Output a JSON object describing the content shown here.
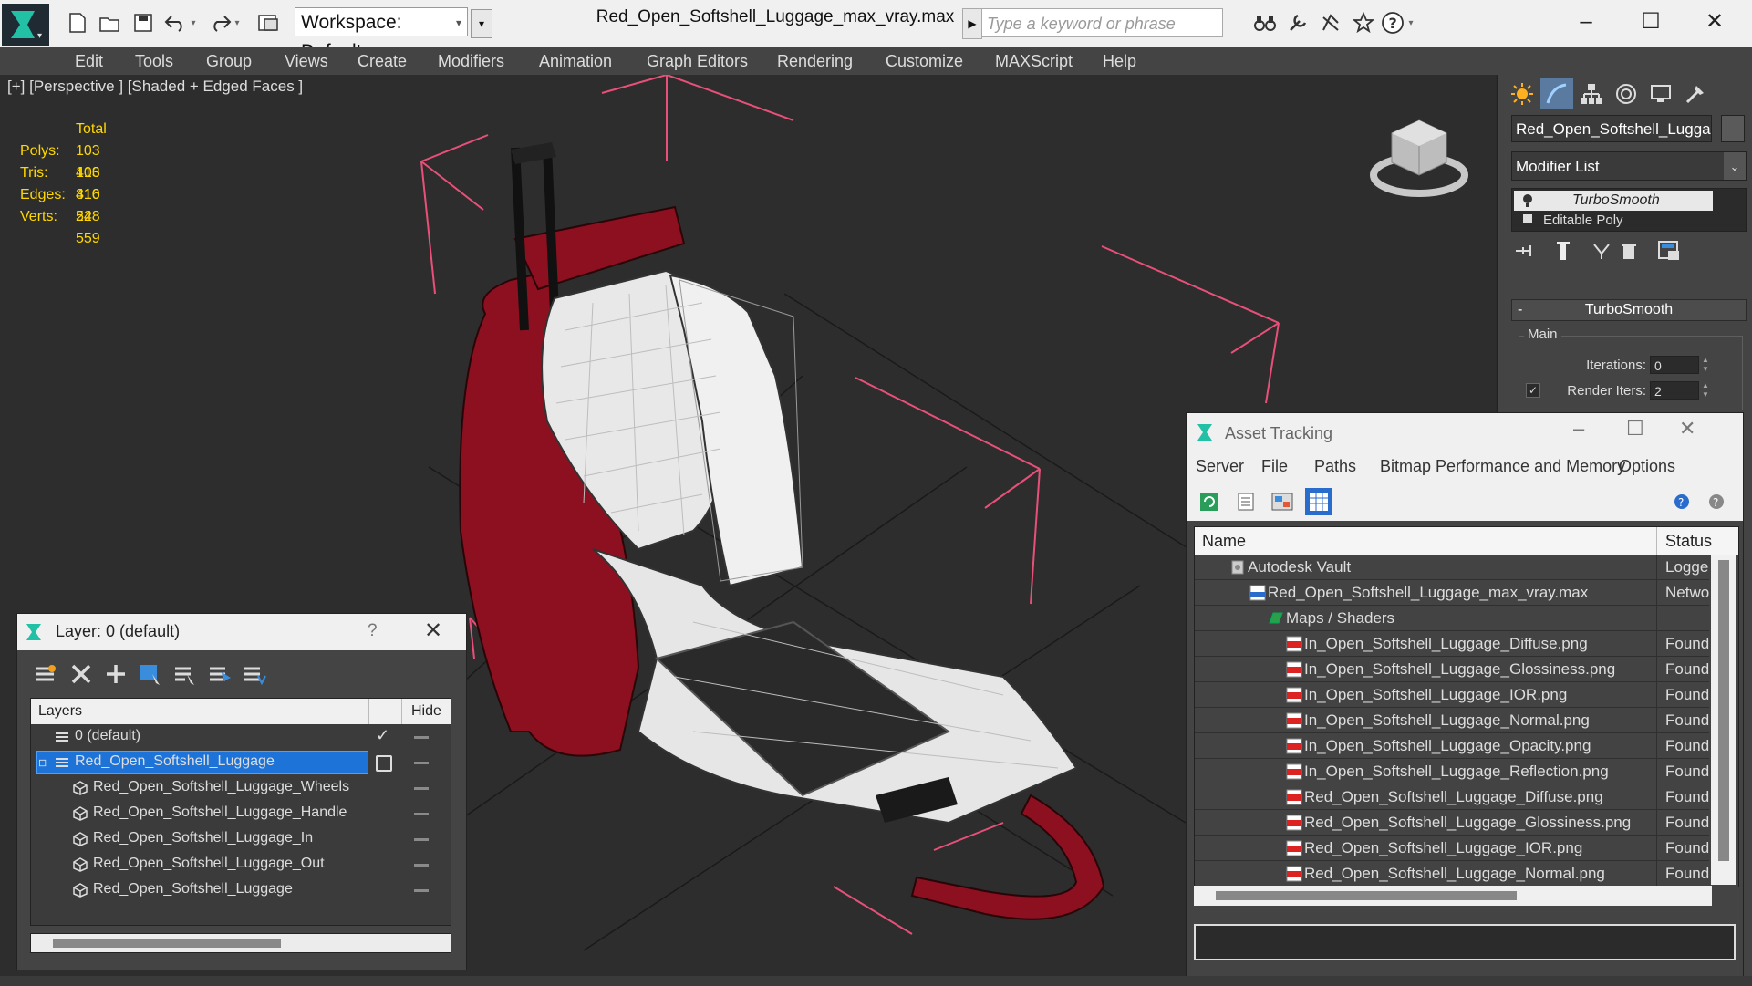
{
  "app": {
    "file_title": "Red_Open_Softshell_Luggage_max_vray.max",
    "workspace_label": "Workspace: Default",
    "search_placeholder": "Type a keyword or phrase"
  },
  "menu": [
    "Edit",
    "Tools",
    "Group",
    "Views",
    "Create",
    "Modifiers",
    "Animation",
    "Graph Editors",
    "Rendering",
    "Customize",
    "MAXScript",
    "Help"
  ],
  "viewport": {
    "label": "[+] [Perspective ] [Shaded + Edged Faces ]",
    "stats": {
      "header": "Total",
      "rows": [
        {
          "label": "Polys:",
          "value": "103 416"
        },
        {
          "label": "Tris:",
          "value": "103 416"
        },
        {
          "label": "Edges:",
          "value": "310 248"
        },
        {
          "label": "Verts:",
          "value": "52 559"
        }
      ]
    },
    "stats_color": "#ffd700",
    "selection_box_color": "#e8507a",
    "model_color": "#8c1020"
  },
  "command_panel": {
    "object_name": "Red_Open_Softshell_Luggage_I",
    "modifier_list": "Modifier List",
    "stack": [
      "TurboSmooth",
      "Editable Poly"
    ],
    "rollout_title": "TurboSmooth",
    "group_label": "Main",
    "iterations_label": "Iterations:",
    "iterations_value": "0",
    "render_iters_label": "Render Iters:",
    "render_iters_value": "2",
    "render_iters_checked": true
  },
  "layer_dialog": {
    "title": "Layer: 0 (default)",
    "help": "?",
    "col_layers": "Layers",
    "col_hide": "Hide",
    "rows": [
      {
        "name": "0 (default)",
        "type": "layer",
        "current": true
      },
      {
        "name": "Red_Open_Softshell_Luggage",
        "type": "layer",
        "selected": true
      },
      {
        "name": "Red_Open_Softshell_Luggage_Wheels",
        "type": "object"
      },
      {
        "name": "Red_Open_Softshell_Luggage_Handle",
        "type": "object"
      },
      {
        "name": "Red_Open_Softshell_Luggage_In",
        "type": "object"
      },
      {
        "name": "Red_Open_Softshell_Luggage_Out",
        "type": "object"
      },
      {
        "name": "Red_Open_Softshell_Luggage",
        "type": "object"
      }
    ],
    "selection_color": "#1e73d8"
  },
  "asset_dialog": {
    "title": "Asset Tracking",
    "menu": [
      "Server",
      "File",
      "Paths",
      "Bitmap Performance and Memory",
      "Options"
    ],
    "col_name": "Name",
    "col_status": "Status",
    "rows": [
      {
        "name": "Autodesk Vault",
        "status": "Logged",
        "icon": "vault-icon"
      },
      {
        "name": "Red_Open_Softshell_Luggage_max_vray.max",
        "status": "Network",
        "icon": "max-file-icon"
      },
      {
        "name": "Maps / Shaders",
        "status": "",
        "icon": "maps-folder-icon"
      },
      {
        "name": "In_Open_Softshell_Luggage_Diffuse.png",
        "status": "Found",
        "icon": "png-icon"
      },
      {
        "name": "In_Open_Softshell_Luggage_Glossiness.png",
        "status": "Found",
        "icon": "png-icon"
      },
      {
        "name": "In_Open_Softshell_Luggage_IOR.png",
        "status": "Found",
        "icon": "png-icon"
      },
      {
        "name": "In_Open_Softshell_Luggage_Normal.png",
        "status": "Found",
        "icon": "png-icon"
      },
      {
        "name": "In_Open_Softshell_Luggage_Opacity.png",
        "status": "Found",
        "icon": "png-icon"
      },
      {
        "name": "In_Open_Softshell_Luggage_Reflection.png",
        "status": "Found",
        "icon": "png-icon"
      },
      {
        "name": "Red_Open_Softshell_Luggage_Diffuse.png",
        "status": "Found",
        "icon": "png-icon"
      },
      {
        "name": "Red_Open_Softshell_Luggage_Glossiness.png",
        "status": "Found",
        "icon": "png-icon"
      },
      {
        "name": "Red_Open_Softshell_Luggage_IOR.png",
        "status": "Found",
        "icon": "png-icon"
      },
      {
        "name": "Red_Open_Softshell_Luggage_Normal.png",
        "status": "Found",
        "icon": "png-icon"
      }
    ]
  }
}
